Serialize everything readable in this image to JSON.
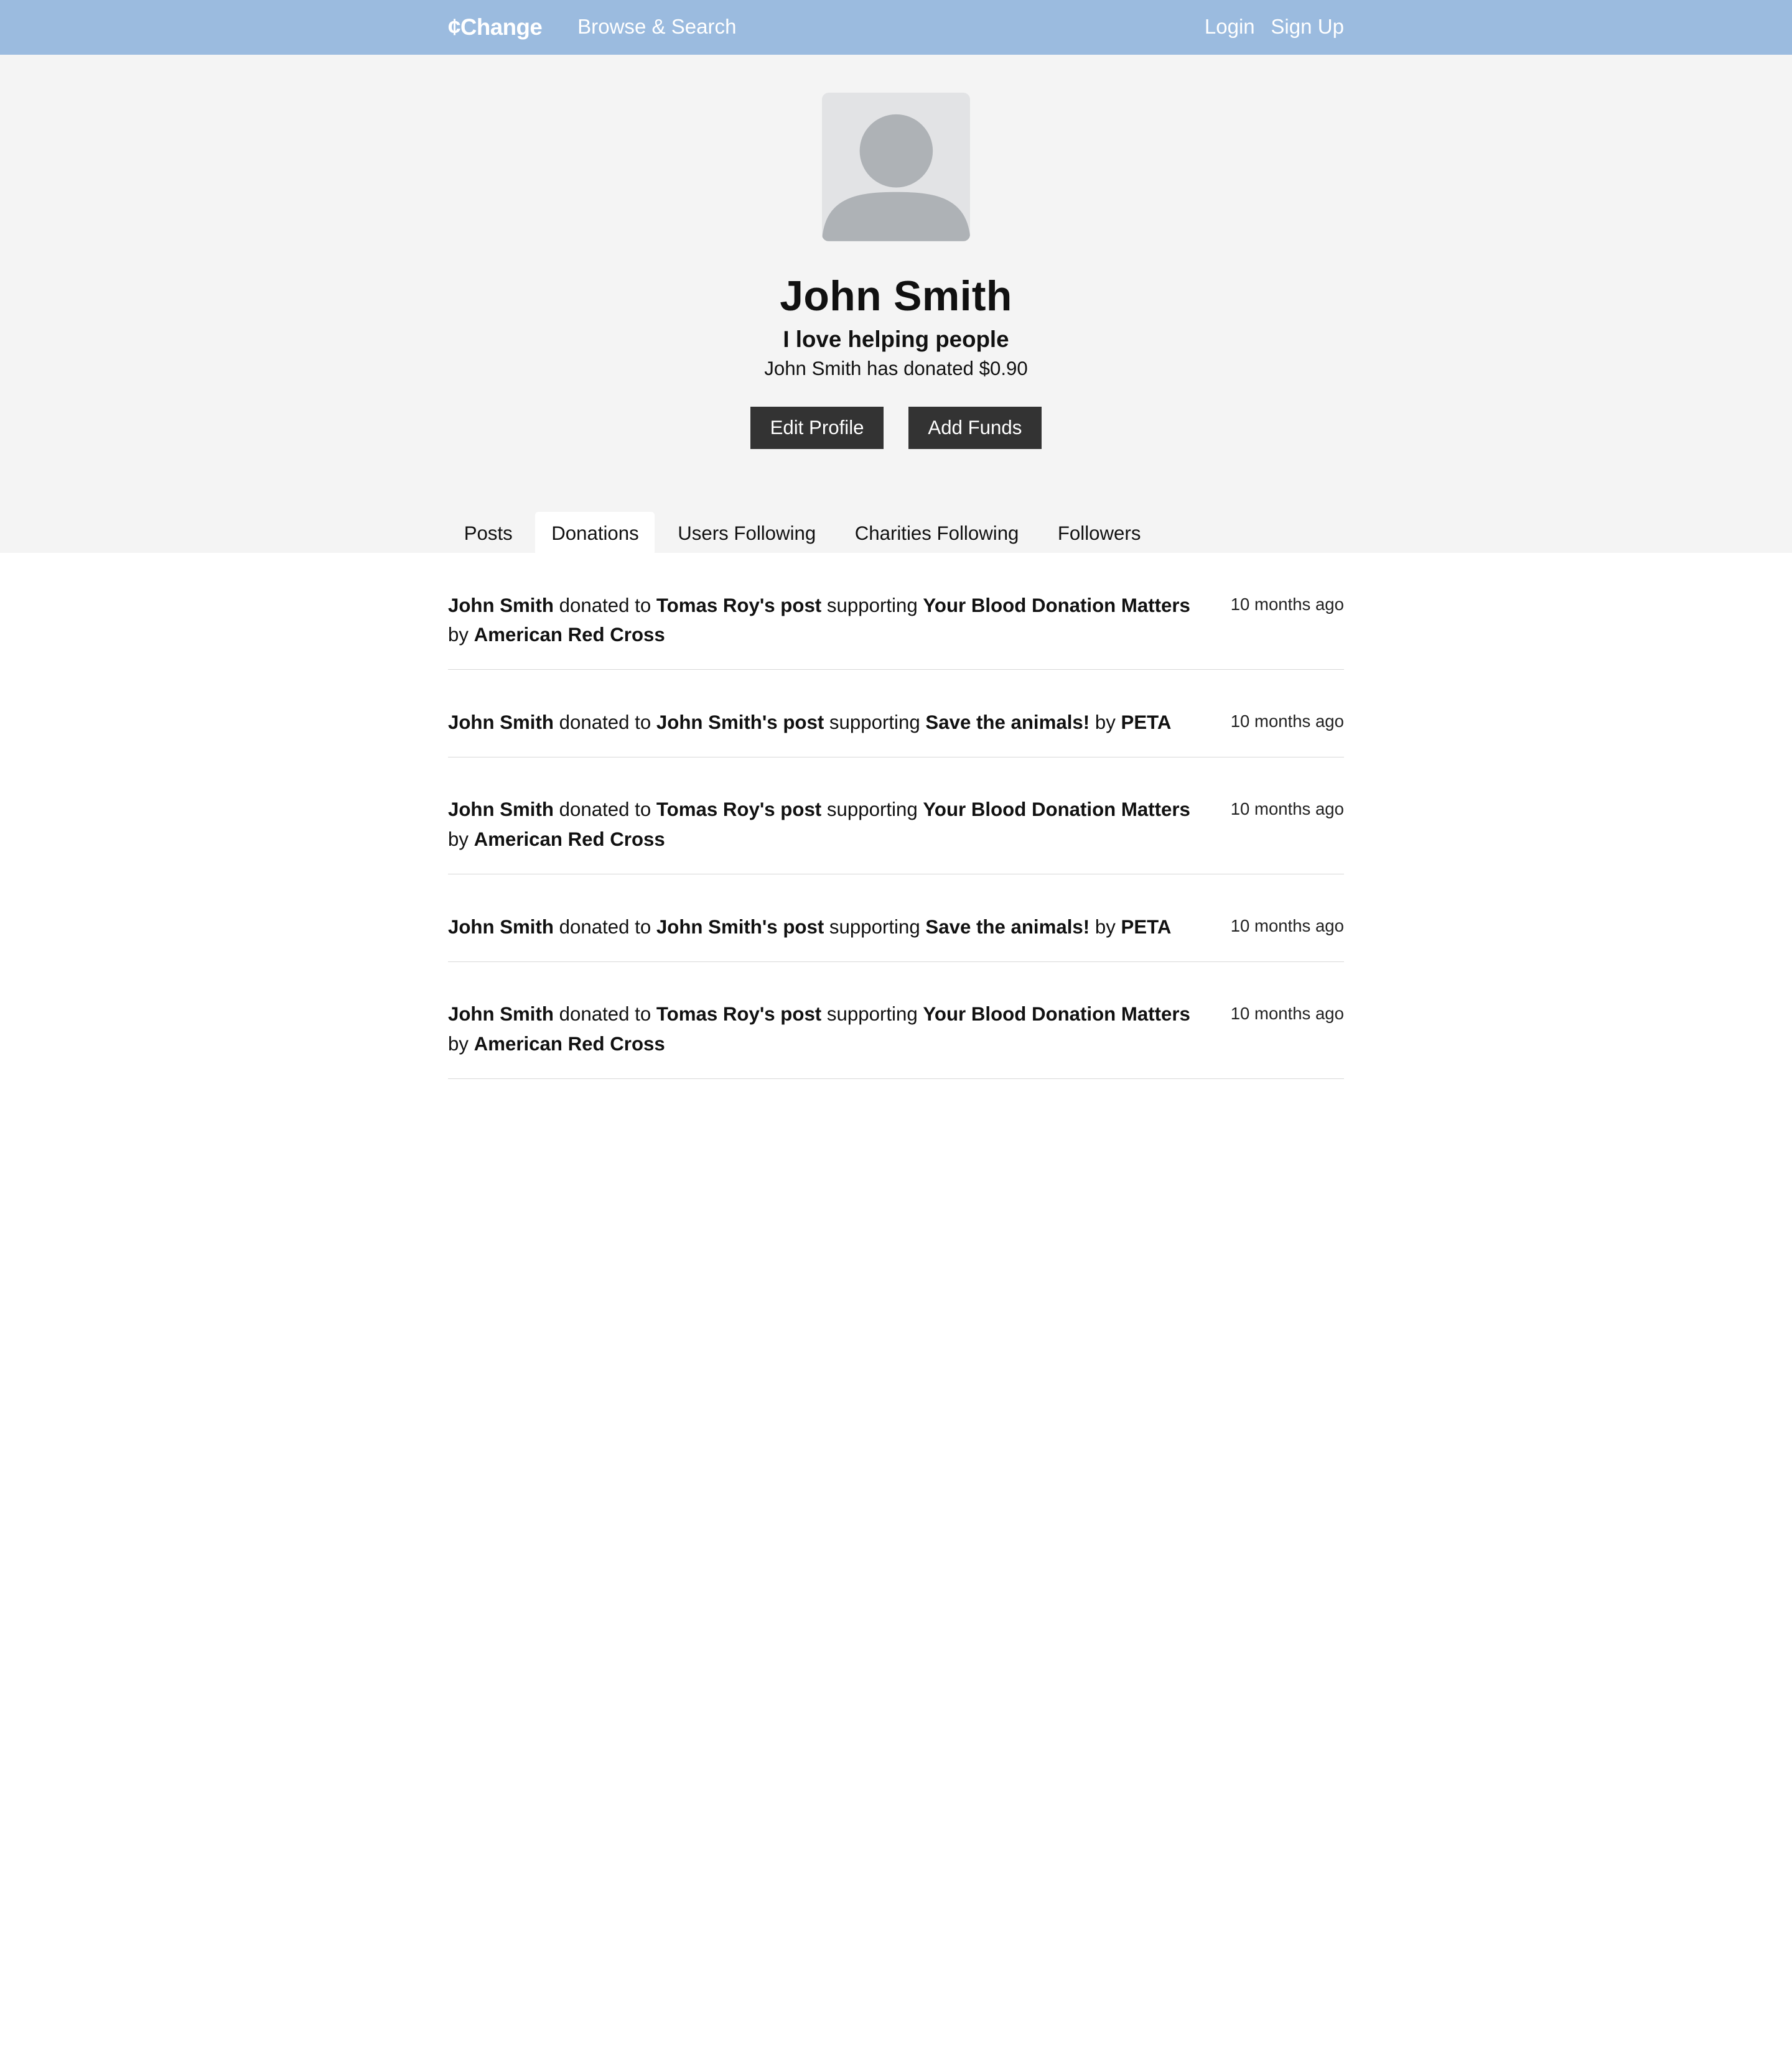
{
  "header": {
    "logo": "¢Change",
    "browse": "Browse & Search",
    "login": "Login",
    "signup": "Sign Up",
    "bg_color": "#9bbbdf"
  },
  "profile": {
    "avatar_icon": "user-silhouette-icon",
    "name": "John Smith",
    "bio": "I love helping people",
    "donated_text": "John Smith has donated $0.90",
    "edit_button": "Edit Profile",
    "add_funds_button": "Add Funds"
  },
  "tabs": [
    {
      "label": "Posts",
      "active": false
    },
    {
      "label": "Donations",
      "active": true
    },
    {
      "label": "Users Following",
      "active": false
    },
    {
      "label": "Charities Following",
      "active": false
    },
    {
      "label": "Followers",
      "active": false
    }
  ],
  "donations": [
    {
      "user": "John Smith",
      "w1": "donated to",
      "post": "Tomas Roy's post",
      "w2": "supporting",
      "cause": "Your Blood Donation Matters",
      "w3": "by",
      "charity": "American Red Cross",
      "time": "10 months ago"
    },
    {
      "user": "John Smith",
      "w1": "donated to",
      "post": "John Smith's post",
      "w2": "supporting",
      "cause": "Save the animals!",
      "w3": "by",
      "charity": "PETA",
      "time": "10 months ago"
    },
    {
      "user": "John Smith",
      "w1": "donated to",
      "post": "Tomas Roy's post",
      "w2": "supporting",
      "cause": "Your Blood Donation Matters",
      "w3": "by",
      "charity": "American Red Cross",
      "time": "10 months ago"
    },
    {
      "user": "John Smith",
      "w1": "donated to",
      "post": "John Smith's post",
      "w2": "supporting",
      "cause": "Save the animals!",
      "w3": "by",
      "charity": "PETA",
      "time": "10 months ago"
    },
    {
      "user": "John Smith",
      "w1": "donated to",
      "post": "Tomas Roy's post",
      "w2": "supporting",
      "cause": "Your Blood Donation Matters",
      "w3": "by",
      "charity": "American Red Cross",
      "time": "10 months ago"
    }
  ]
}
